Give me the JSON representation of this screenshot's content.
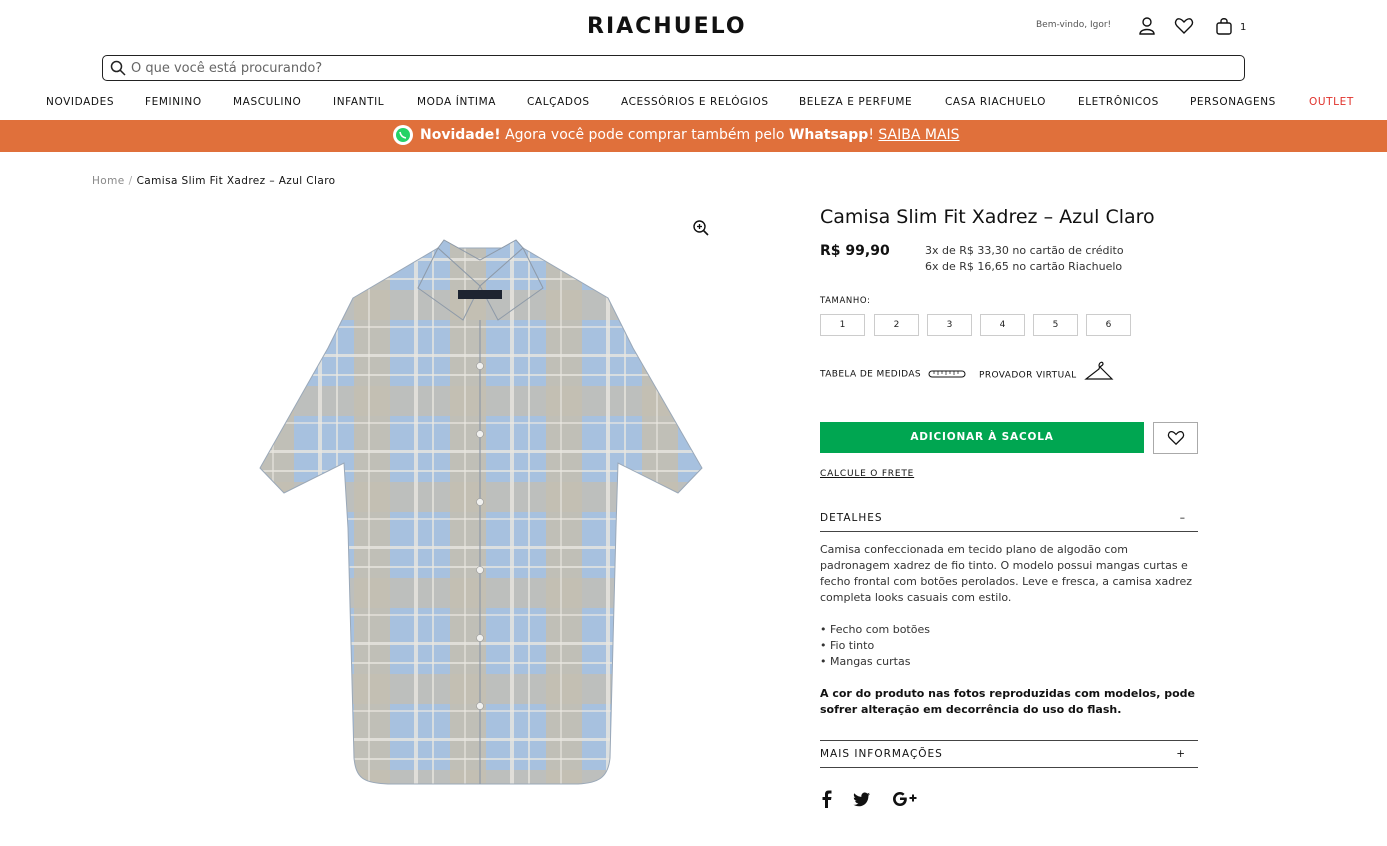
{
  "header": {
    "logo": "RIACHUELO",
    "welcome": "Bem-vindo, Igor!",
    "bag_count": "1",
    "icons": [
      "user-icon",
      "heart-icon",
      "bag-icon"
    ]
  },
  "search": {
    "placeholder": "O que você está procurando?"
  },
  "nav": {
    "items": [
      "NOVIDADES",
      "FEMININO",
      "MASCULINO",
      "INFANTIL",
      "MODA ÍNTIMA",
      "CALÇADOS",
      "ACESSÓRIOS E RELÓGIOS",
      "BELEZA E PERFUME",
      "CASA RIACHUELO",
      "ELETRÔNICOS",
      "PERSONAGENS",
      "OUTLET"
    ],
    "outlet_color": "#e0312b"
  },
  "banner": {
    "bold1": "Novidade!",
    "text1": " Agora você pode comprar também pelo ",
    "bold2": "Whatsapp",
    "text2": "! ",
    "link": "SAIBA MAIS",
    "color": "#e0703b"
  },
  "breadcrumb": {
    "home": "Home",
    "separator": "/",
    "current": "Camisa Slim Fit Xadrez – Azul Claro"
  },
  "product": {
    "title": "Camisa Slim Fit Xadrez – Azul Claro",
    "price": "R$ 99,90",
    "installments": [
      "3x de R$ 33,30 no cartão de crédito",
      "6x de R$ 16,65 no cartão Riachuelo"
    ],
    "size_label": "TAMANHO:",
    "sizes": [
      "1",
      "2",
      "3",
      "4",
      "5",
      "6"
    ],
    "size_chart": "TABELA DE MEDIDAS",
    "virtual_fitting": "PROVADOR VIRTUAL",
    "add_to_bag": "ADICIONAR À SACOLA",
    "add_color": "#00a651",
    "shipping": "CALCULE O FRETE"
  },
  "details": {
    "label": "DETALHES",
    "sign": "–",
    "description": "Camisa confeccionada em tecido plano de algodão com padronagem xadrez de fio tinto. O modelo possui mangas curtas e fecho frontal com botões perolados. Leve e fresca, a camisa xadrez completa looks casuais com estilo.",
    "bullets": [
      "• Fecho com botões",
      "• Fio tinto",
      "• Mangas curtas"
    ],
    "note": "A cor do produto nas fotos reproduzidas com modelos, pode sofrer alteração em decorrência do uso do flash."
  },
  "more_info": {
    "label": "MAIS INFORMAÇÕES",
    "sign": "+"
  },
  "social": [
    "facebook-icon",
    "twitter-icon",
    "google-plus-icon"
  ]
}
